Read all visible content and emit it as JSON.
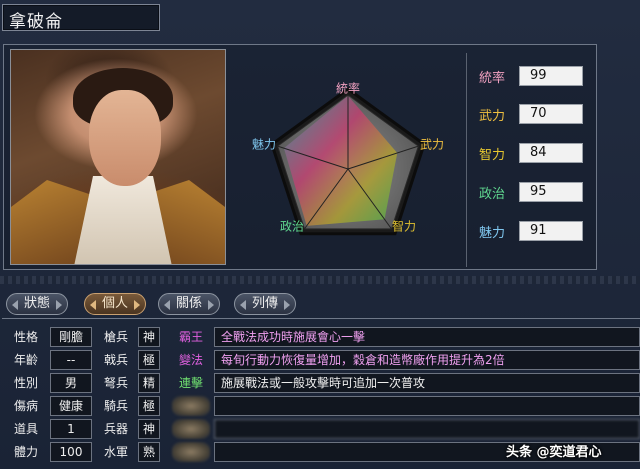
{
  "header": {
    "name": "拿破侖"
  },
  "radar": {
    "axes": [
      {
        "label": "統率",
        "value": 99,
        "color": "#f0a0c0"
      },
      {
        "label": "武力",
        "value": 70,
        "color": "#f0c040"
      },
      {
        "label": "智力",
        "value": 84,
        "color": "#e0c030"
      },
      {
        "label": "政治",
        "value": 95,
        "color": "#60d890"
      },
      {
        "label": "魅力",
        "value": 91,
        "color": "#80c8f0"
      }
    ],
    "max": 100
  },
  "stats": [
    {
      "label": "統率",
      "value": "99",
      "color": "#f0a0c0"
    },
    {
      "label": "武力",
      "value": "70",
      "color": "#f0c040"
    },
    {
      "label": "智力",
      "value": "84",
      "color": "#e8c830"
    },
    {
      "label": "政治",
      "value": "95",
      "color": "#60d890"
    },
    {
      "label": "魅力",
      "value": "91",
      "color": "#80c8f0"
    }
  ],
  "tabs": [
    {
      "label": "狀態",
      "active": false
    },
    {
      "label": "個人",
      "active": true
    },
    {
      "label": "關係",
      "active": false
    },
    {
      "label": "列傳",
      "active": false
    }
  ],
  "personal": [
    {
      "label": "性格",
      "value": "剛膽"
    },
    {
      "label": "年齡",
      "value": "--"
    },
    {
      "label": "性別",
      "value": "男"
    },
    {
      "label": "傷病",
      "value": "健康"
    },
    {
      "label": "道具",
      "value": "1"
    },
    {
      "label": "體力",
      "value": "100"
    }
  ],
  "aptitude": [
    {
      "label": "槍兵",
      "value": "神"
    },
    {
      "label": "戟兵",
      "value": "極"
    },
    {
      "label": "弩兵",
      "value": "精"
    },
    {
      "label": "騎兵",
      "value": "極"
    },
    {
      "label": "兵器",
      "value": "神"
    },
    {
      "label": "水軍",
      "value": "熟"
    }
  ],
  "skills": [
    {
      "name": "霸王",
      "color": "#e060e0",
      "desc": "全戰法成功時施展會心一擊",
      "desc_color": "#f0a0f0"
    },
    {
      "name": "變法",
      "color": "#e060e0",
      "desc": "每旬行動力恢復量增加，穀倉和造幣廠作用提升為2倍",
      "desc_color": "#f0a0f0"
    },
    {
      "name": "連擊",
      "color": "#70e070",
      "desc": "施展戰法或一般攻擊時可追加一次普攻",
      "desc_color": "#f0f0f0"
    },
    {
      "name": "",
      "color": "#888",
      "desc": "",
      "desc_color": "#f0f0f0"
    },
    {
      "name": "",
      "color": "#888",
      "desc": "",
      "desc_color": "#f0f0f0"
    },
    {
      "name": "",
      "color": "#888",
      "desc": "",
      "desc_color": "#f0f0f0"
    }
  ],
  "watermark": "头条 @奕道君心"
}
